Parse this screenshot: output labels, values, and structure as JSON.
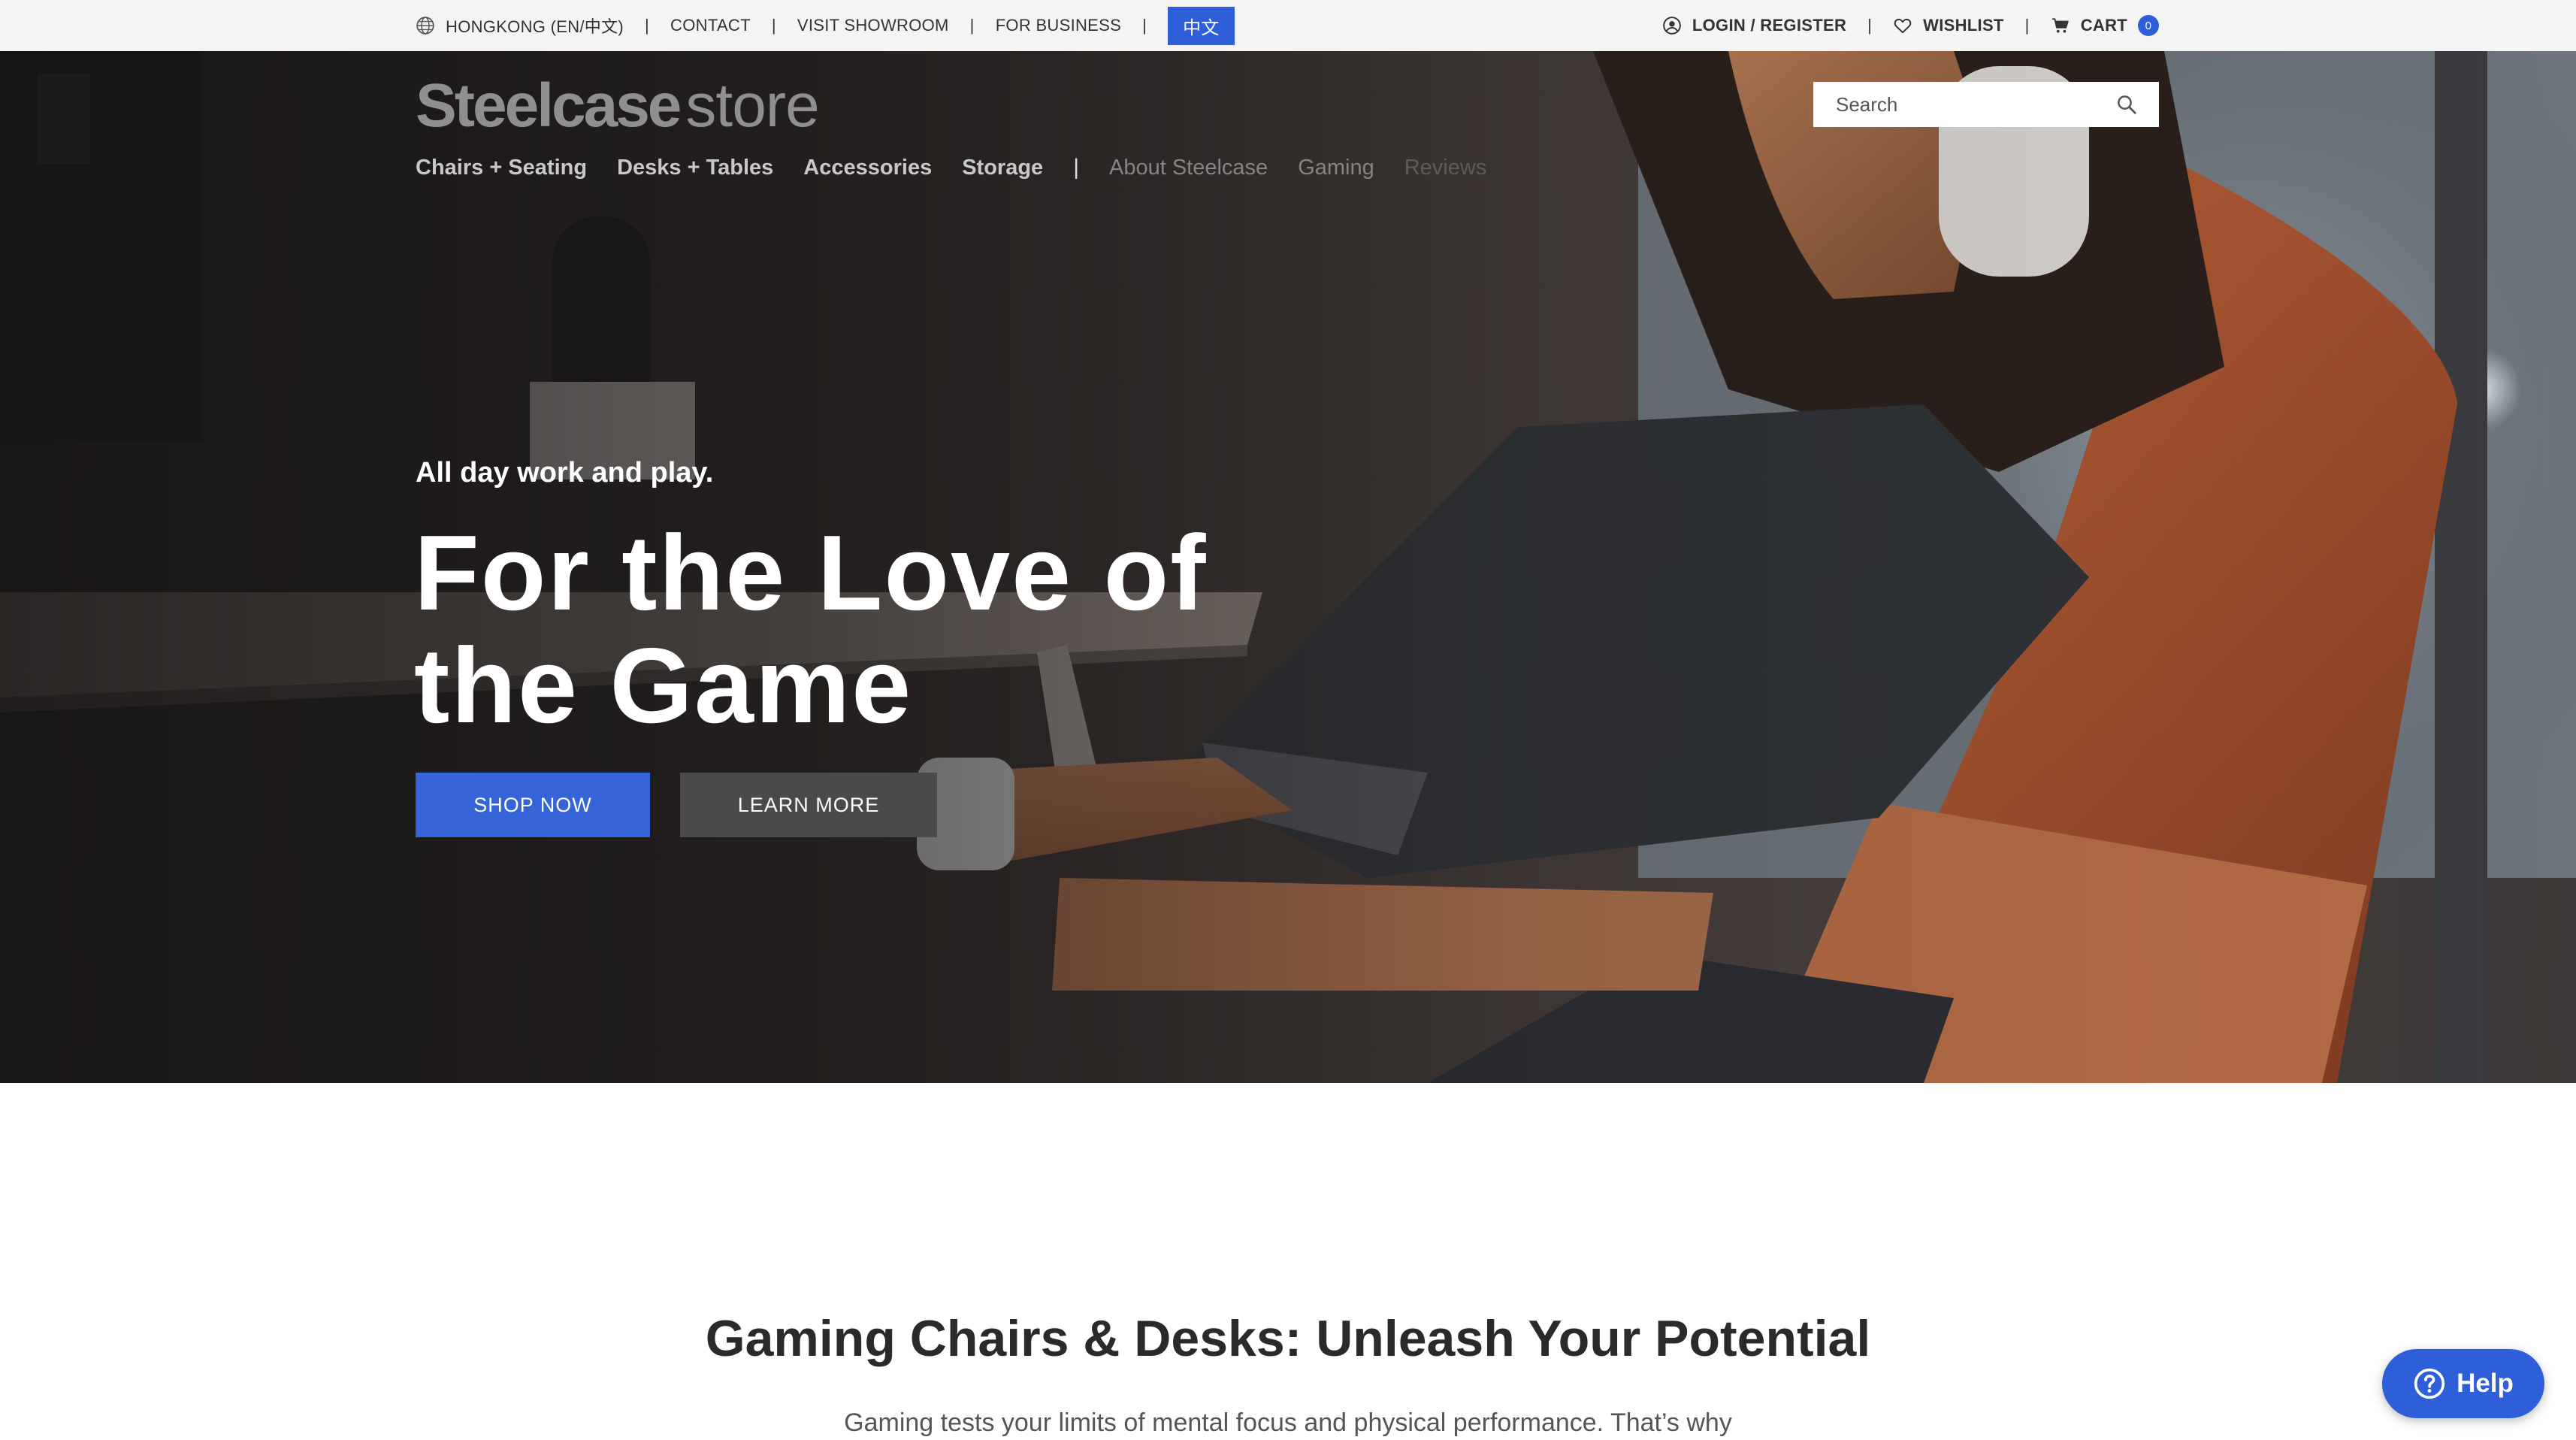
{
  "utility_bar": {
    "region": "HONGKONG (EN/中文)",
    "links": [
      "CONTACT",
      "VISIT SHOWROOM",
      "FOR BUSINESS"
    ],
    "language_button": "中文",
    "account": "LOGIN / REGISTER",
    "wishlist": "WISHLIST",
    "cart": "CART",
    "cart_count": "0",
    "icons": {
      "region": "globe-icon",
      "account": "user-circle-icon",
      "wishlist": "heart-icon",
      "cart": "cart-icon"
    }
  },
  "header": {
    "logo_brand": "Steelcase",
    "logo_suffix": "store",
    "search_placeholder": "Search",
    "search_icon": "search-icon",
    "nav_primary": [
      "Chairs + Seating",
      "Desks + Tables",
      "Accessories",
      "Storage"
    ],
    "nav_secondary": [
      "About Steelcase",
      "Gaming",
      "Reviews"
    ]
  },
  "hero": {
    "eyebrow": "All day work and play.",
    "headline_line1": "For the Love of",
    "headline_line2": "the Game",
    "primary_cta": "SHOP NOW",
    "secondary_cta": "LEARN MORE"
  },
  "section": {
    "title": "Gaming Chairs & Desks: Unleash Your Potential",
    "text": "Gaming tests your limits of mental focus and physical performance. That’s why"
  },
  "help": {
    "label": "Help",
    "icon": "question-circle-icon"
  },
  "colors": {
    "accent_blue": "#3564d9",
    "cart_badge": "#2f5fd8",
    "secondary_button": "#4a4a4a",
    "utility_bar_bg": "#f4f4f4",
    "chair_orange": "#b4572f"
  }
}
